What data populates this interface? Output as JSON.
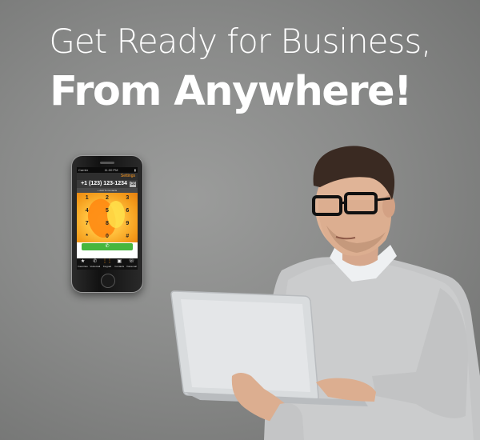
{
  "headline": {
    "line1": "Get Ready for Business,",
    "line2": "From Anywhere!"
  },
  "phone": {
    "status_left": "Carrier",
    "status_center": "11:00 PM",
    "settings_label": "Settings",
    "phone_number": "+1 (123) 123-1234",
    "backspace_icon": "backspace-icon",
    "carrier_line": "+ Add To Contacts",
    "keys": [
      "1",
      "2",
      "3",
      "4",
      "5",
      "6",
      "7",
      "8",
      "9",
      "*",
      "0",
      "#"
    ],
    "call_icon": "phone-icon",
    "tabs": [
      {
        "label": "Favorites",
        "icon": "★"
      },
      {
        "label": "Voicemail",
        "icon": "✆"
      },
      {
        "label": "Keypad",
        "icon": "⋮⋮"
      },
      {
        "label": "Contacts",
        "icon": "▣"
      },
      {
        "label": "Voicemail",
        "icon": "☏"
      }
    ],
    "accent_color": "#ff9a1e",
    "call_color": "#47b63e"
  }
}
